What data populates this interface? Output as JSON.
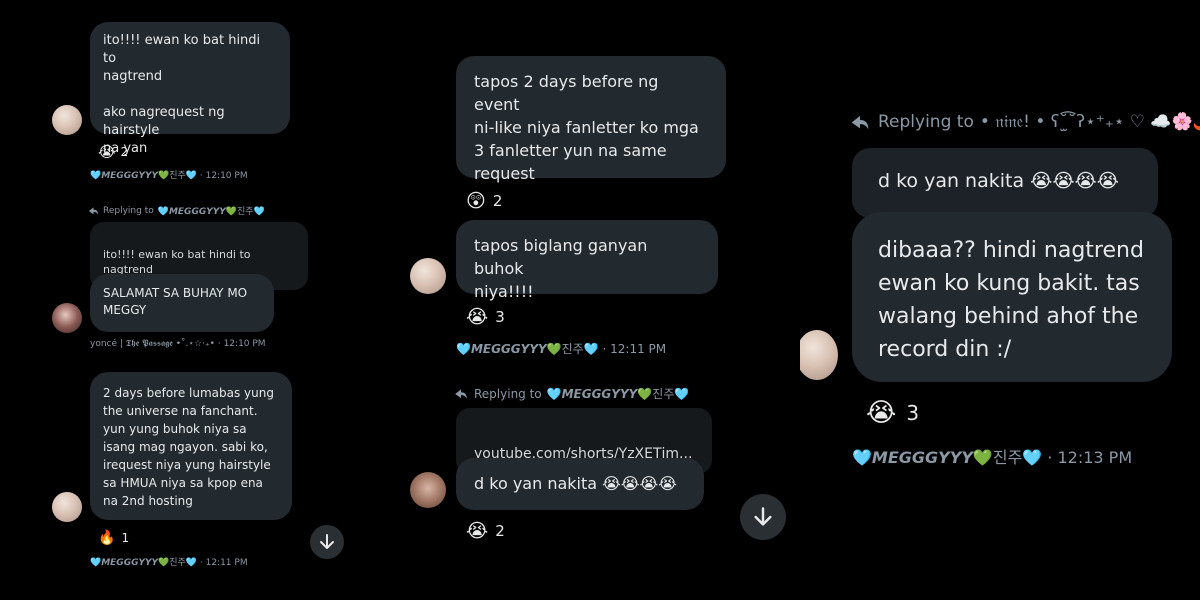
{
  "panel1": {
    "msg1": "ito!!!! ewan ko bat hindi to\nnagtrend\n\nako nagrequest ng hairstyle\nna yan",
    "react1": {
      "emoji": "😭",
      "count": "2"
    },
    "meta1": {
      "name": "🩵𝙈𝙀𝙂𝙂𝙂𝙔𝙔𝙔💚진주🩵",
      "time": "· 12:10 PM"
    },
    "reply_label": "Replying to",
    "reply_name": "🩵𝙈𝙀𝙂𝙂𝙂𝙔𝙔𝙔💚진주🩵",
    "quote": "ito!!!! ewan ko bat hindi to nagtrend",
    "quote_more": "...",
    "msg2": "SALAMAT SA BUHAY MO\nMEGGY",
    "meta2": {
      "name": "yoncé | 𝕿𝖍𝖊 𝕻𝖆𝖘𝖘𝖆𝖌𝖊 •˚.⋆☆‧₊•",
      "time": "· 12:10 PM"
    },
    "msg3": "2 days before lumabas yung\nthe universe na fanchant.\nyun yung buhok niya sa\nisang mag ngayon. sabi ko,\nirequest niya yung hairstyle\nsa HMUA niya sa kpop ena\nna 2nd hosting",
    "react3": {
      "emoji": "🔥",
      "count": "1"
    },
    "meta3": {
      "name": "🩵𝙈𝙀𝙂𝙂𝙂𝙔𝙔𝙔💚진주🩵",
      "time": "· 12:11 PM"
    }
  },
  "panel2": {
    "msg1": "tapos 2 days before ng event\nni-like niya fanletter ko mga\n3 fanletter yun na same\nrequest",
    "react1": {
      "emoji": "😲",
      "count": "2"
    },
    "msg2": "tapos biglang ganyan buhok\nniya!!!!",
    "react2": {
      "emoji": "😭",
      "count": "3"
    },
    "meta1": {
      "name": "🩵𝙈𝙀𝙂𝙂𝙂𝙔𝙔𝙔💚진주🩵",
      "time": "· 12:11 PM"
    },
    "reply_label": "Replying to",
    "reply_name": "🩵𝙈𝙀𝙂𝙂𝙂𝙔𝙔𝙔💚진주🩵",
    "quote": "youtube.com/shorts/YzXETjm...",
    "msg3": "d ko yan nakita 😭😭😭😭",
    "react3": {
      "emoji": "😭",
      "count": "2"
    }
  },
  "panel3": {
    "reply_label": "Replying to",
    "reply_name": "• 𝔫𝔦𝔫𝔢! • ʕ˘̫͡˘ʔ⋆⁺₊⋆ ♡ ☁️🌸🌶️",
    "msg1": "d ko yan nakita 😭😭😭😭",
    "msg2": "dibaaa?? hindi nagtrend\newan ko kung bakit. tas\nwalang behind ahof the\nrecord din :/",
    "react1": {
      "emoji": "😭",
      "count": "3"
    },
    "meta1": {
      "name": "🩵𝙈𝙀𝙂𝙂𝙂𝙔𝙔𝙔💚진주🩵",
      "time": "· 12:13 PM"
    }
  },
  "colors": {
    "bubble": "#22292f",
    "background": "#000000",
    "meta": "#8b98a5"
  },
  "icons": {
    "reply": "reply-arrow-icon",
    "scroll": "arrow-down-icon"
  }
}
